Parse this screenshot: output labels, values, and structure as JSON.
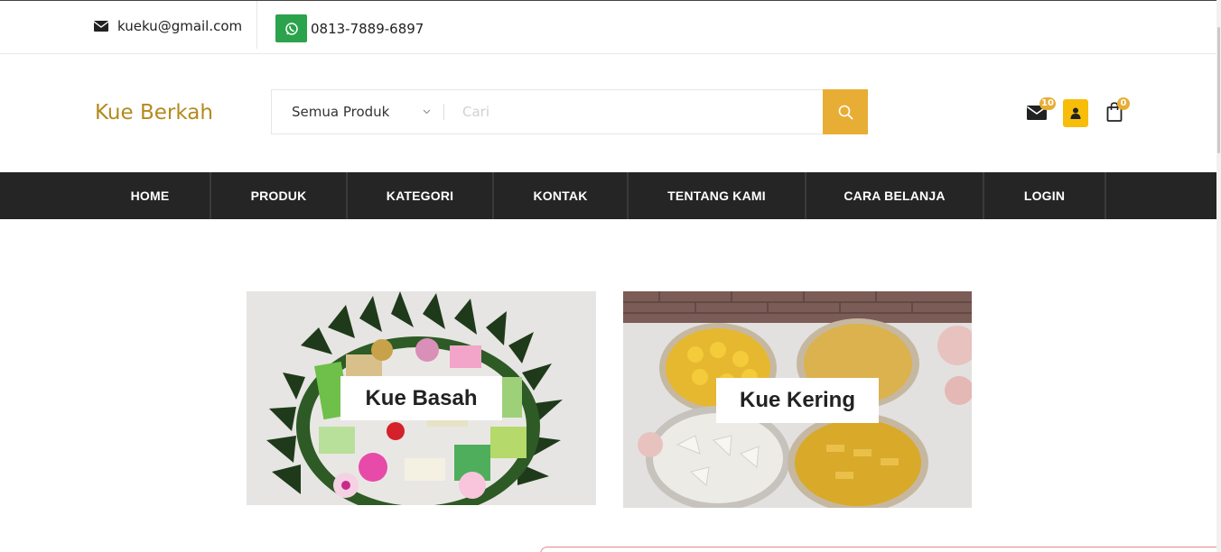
{
  "topbar": {
    "email": "kueku@gmail.com",
    "phone": "0813-7889-6897"
  },
  "header": {
    "brand": "Kue Berkah",
    "search": {
      "category_selected": "Semua Produk",
      "placeholder": "Cari"
    },
    "icons": {
      "messages_count": "10",
      "cart_count": "0"
    }
  },
  "nav": {
    "items": [
      {
        "label": "HOME"
      },
      {
        "label": "PRODUK"
      },
      {
        "label": "KATEGORI"
      },
      {
        "label": "KONTAK"
      },
      {
        "label": "TENTANG KAMI"
      },
      {
        "label": "CARA BELANJA"
      },
      {
        "label": "LOGIN"
      }
    ]
  },
  "categories": [
    {
      "label": "Kue Basah"
    },
    {
      "label": "Kue Kering"
    }
  ],
  "colors": {
    "accent": "#e8ad34",
    "brand": "#b48a1e",
    "nav_bg": "#252525",
    "whatsapp": "#2ba24c",
    "user_icon": "#f7bd09"
  }
}
